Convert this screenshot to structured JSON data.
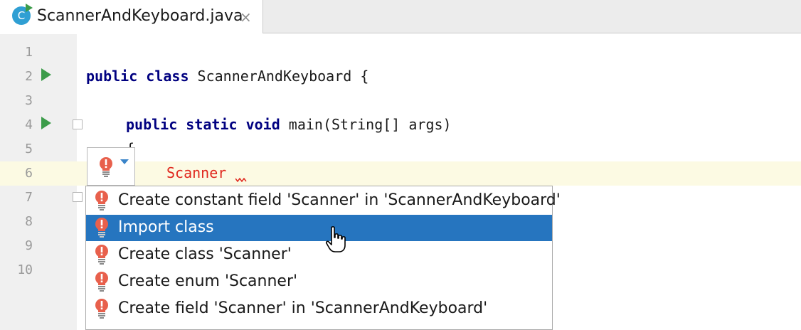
{
  "tab": {
    "icon_letter": "C",
    "file_name": "ScannerAndKeyboard.java",
    "close_glyph": "×"
  },
  "editor": {
    "line_numbers": [
      "1",
      "2",
      "3",
      "4",
      "5",
      "6",
      "7",
      "8",
      "9",
      "10"
    ],
    "code": {
      "line2_kw1": "public",
      "line2_kw2": "class",
      "line2_rest": " ScannerAndKeyboard {",
      "line4_kw1": "public",
      "line4_kw2": "static",
      "line4_kw3": "void",
      "line4_rest": " main(String[] args)",
      "line5": "{",
      "line6_error": "Scanner"
    }
  },
  "popup": {
    "items": [
      {
        "label": "Create constant field 'Scanner' in 'ScannerAndKeyboard'"
      },
      {
        "label": "Import class",
        "selected": true
      },
      {
        "label": "Create class 'Scanner'"
      },
      {
        "label": "Create enum 'Scanner'"
      },
      {
        "label": "Create field 'Scanner' in 'ScannerAndKeyboard'"
      }
    ]
  },
  "colors": {
    "keyword": "#000080",
    "error": "#e0281e",
    "selection": "#2675bf",
    "run_arrow": "#3c9c4a",
    "bulb": "#e8604c"
  }
}
